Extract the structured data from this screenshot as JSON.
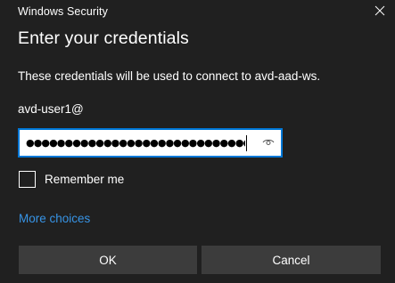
{
  "window": {
    "title": "Windows Security",
    "close_icon": "close-icon"
  },
  "dialog": {
    "heading": "Enter your credentials",
    "description": "These credentials will be used to connect to avd-aad-ws.",
    "username": "avd-user1@",
    "password_masked": "●●●●●●●●●●●●●●●●●●●●●●●●●●●●●●",
    "reveal_icon": "eye-icon",
    "remember_me_label": "Remember me",
    "remember_me_checked": false,
    "more_choices_label": "More choices"
  },
  "buttons": {
    "ok_label": "OK",
    "cancel_label": "Cancel"
  },
  "colors": {
    "background": "#202020",
    "accent": "#0078d7",
    "link": "#3794e6",
    "button_bg": "#3c3c3c"
  }
}
